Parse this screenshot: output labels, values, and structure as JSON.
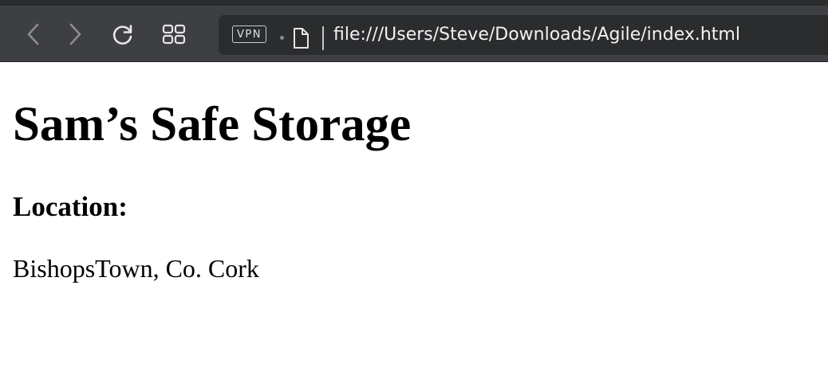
{
  "browser": {
    "vpn_label": "VPN",
    "url": "file:///Users/Steve/Downloads/Agile/index.html",
    "icons": {
      "back": "chevron-left-icon",
      "forward": "chevron-right-icon",
      "reload": "reload-icon",
      "tabs": "tab-grid-icon",
      "page": "document-icon"
    },
    "colors": {
      "toolbar": "#3d3f42",
      "address_bar": "#2a2c2e",
      "url_text": "#f2f2f3"
    }
  },
  "page": {
    "title": "Sam’s Safe Storage",
    "location_heading": "Location:",
    "location_value": "BishopsTown, Co. Cork"
  }
}
